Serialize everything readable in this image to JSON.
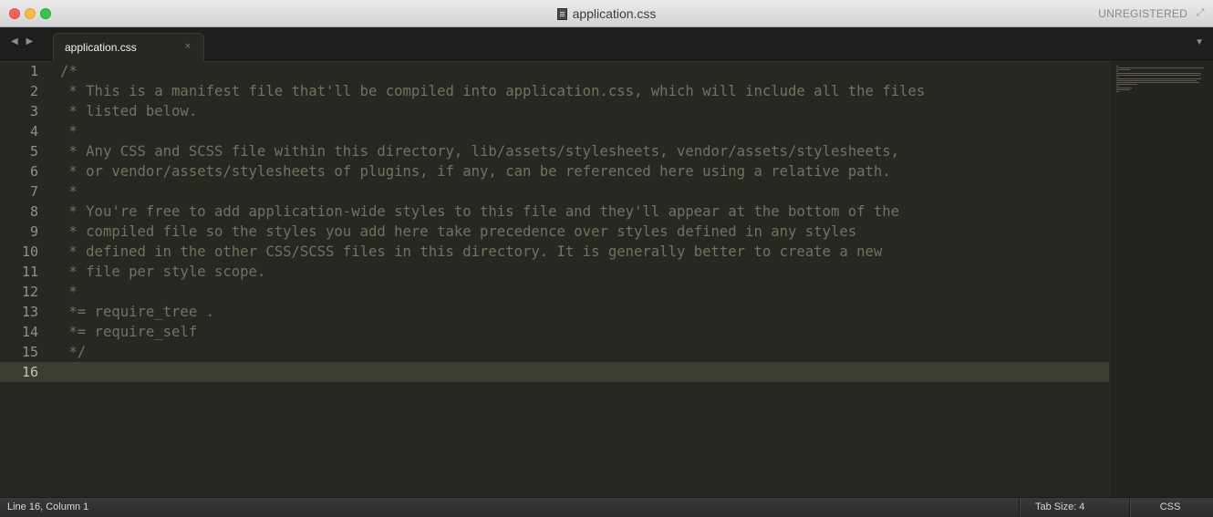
{
  "window": {
    "title": "application.css",
    "registration": "UNREGISTERED"
  },
  "tabs": [
    {
      "label": "application.css",
      "close": "×"
    }
  ],
  "editor": {
    "lines": [
      {
        "num": "1",
        "text": "/*"
      },
      {
        "num": "2",
        "text": " * This is a manifest file that'll be compiled into application.css, which will include all the files"
      },
      {
        "num": "3",
        "text": " * listed below."
      },
      {
        "num": "4",
        "text": " *"
      },
      {
        "num": "5",
        "text": " * Any CSS and SCSS file within this directory, lib/assets/stylesheets, vendor/assets/stylesheets,"
      },
      {
        "num": "6",
        "text": " * or vendor/assets/stylesheets of plugins, if any, can be referenced here using a relative path."
      },
      {
        "num": "7",
        "text": " *"
      },
      {
        "num": "8",
        "text": " * You're free to add application-wide styles to this file and they'll appear at the bottom of the"
      },
      {
        "num": "9",
        "text": " * compiled file so the styles you add here take precedence over styles defined in any styles"
      },
      {
        "num": "10",
        "text": " * defined in the other CSS/SCSS files in this directory. It is generally better to create a new"
      },
      {
        "num": "11",
        "text": " * file per style scope."
      },
      {
        "num": "12",
        "text": " *"
      },
      {
        "num": "13",
        "text": " *= require_tree ."
      },
      {
        "num": "14",
        "text": " *= require_self"
      },
      {
        "num": "15",
        "text": " */"
      },
      {
        "num": "16",
        "text": ""
      }
    ],
    "current_line": "16"
  },
  "status": {
    "position": "Line 16, Column 1",
    "tab_size": "Tab Size: 4",
    "syntax": "CSS"
  },
  "colors": {
    "background": "#272822",
    "comment": "#75715e",
    "line_number": "#8f908a",
    "current_line": "#3e3d32"
  }
}
